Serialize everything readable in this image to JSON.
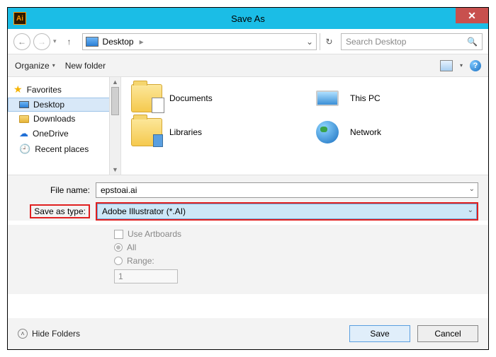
{
  "window": {
    "title": "Save As",
    "close": "✕",
    "app_abbrev": "Ai"
  },
  "nav": {
    "location_crumb": "Desktop",
    "crumb_sep": "▸",
    "dropdown_glyph": "⌄",
    "refresh_glyph": "↻"
  },
  "search": {
    "placeholder": "Search Desktop",
    "icon": "🔍"
  },
  "toolbar": {
    "organize": "Organize",
    "newfolder": "New folder",
    "dd": "▾",
    "help": "?"
  },
  "sidebar": {
    "group": "Favorites",
    "items": [
      {
        "label": "Desktop"
      },
      {
        "label": "Downloads"
      },
      {
        "label": "OneDrive"
      },
      {
        "label": "Recent places"
      }
    ]
  },
  "content": {
    "items": [
      {
        "label": "Documents"
      },
      {
        "label": "This PC"
      },
      {
        "label": "Libraries"
      },
      {
        "label": "Network"
      }
    ]
  },
  "form": {
    "filename_label": "File name:",
    "filename_value": "epstoai.ai",
    "savetype_label": "Save as type:",
    "savetype_value": "Adobe Illustrator (*.AI)"
  },
  "options": {
    "use_artboards": "Use Artboards",
    "all": "All",
    "range": "Range:",
    "range_value": "1"
  },
  "footer": {
    "hide": "Hide Folders",
    "save": "Save",
    "cancel": "Cancel"
  }
}
